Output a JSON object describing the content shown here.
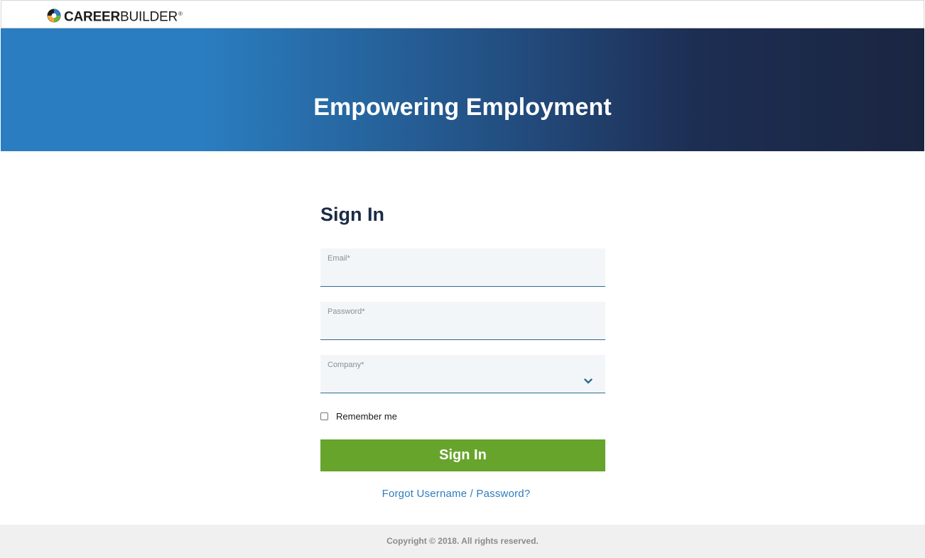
{
  "header": {
    "logo_bold": "CAREER",
    "logo_light": "BUILDER",
    "logo_mark": "®"
  },
  "hero": {
    "title": "Empowering Employment"
  },
  "form": {
    "title": "Sign In",
    "email_label": "Email*",
    "email_value": "",
    "password_label": "Password*",
    "password_value": "",
    "company_label": "Company*",
    "company_value": "",
    "remember_label": "Remember me",
    "remember_checked": false,
    "submit_label": "Sign In",
    "forgot_label": "Forgot Username / Password?"
  },
  "footer": {
    "copyright": "Copyright © 2018. All rights reserved."
  },
  "colors": {
    "primary_blue": "#2a7dc0",
    "dark_navy": "#1a2541",
    "button_green": "#67a42b",
    "link_blue": "#2e7cbf",
    "field_background": "#f3f6f8"
  },
  "icons": {
    "logo": "careerbuilder-logo-icon",
    "company_dropdown": "chevron-down-icon"
  }
}
